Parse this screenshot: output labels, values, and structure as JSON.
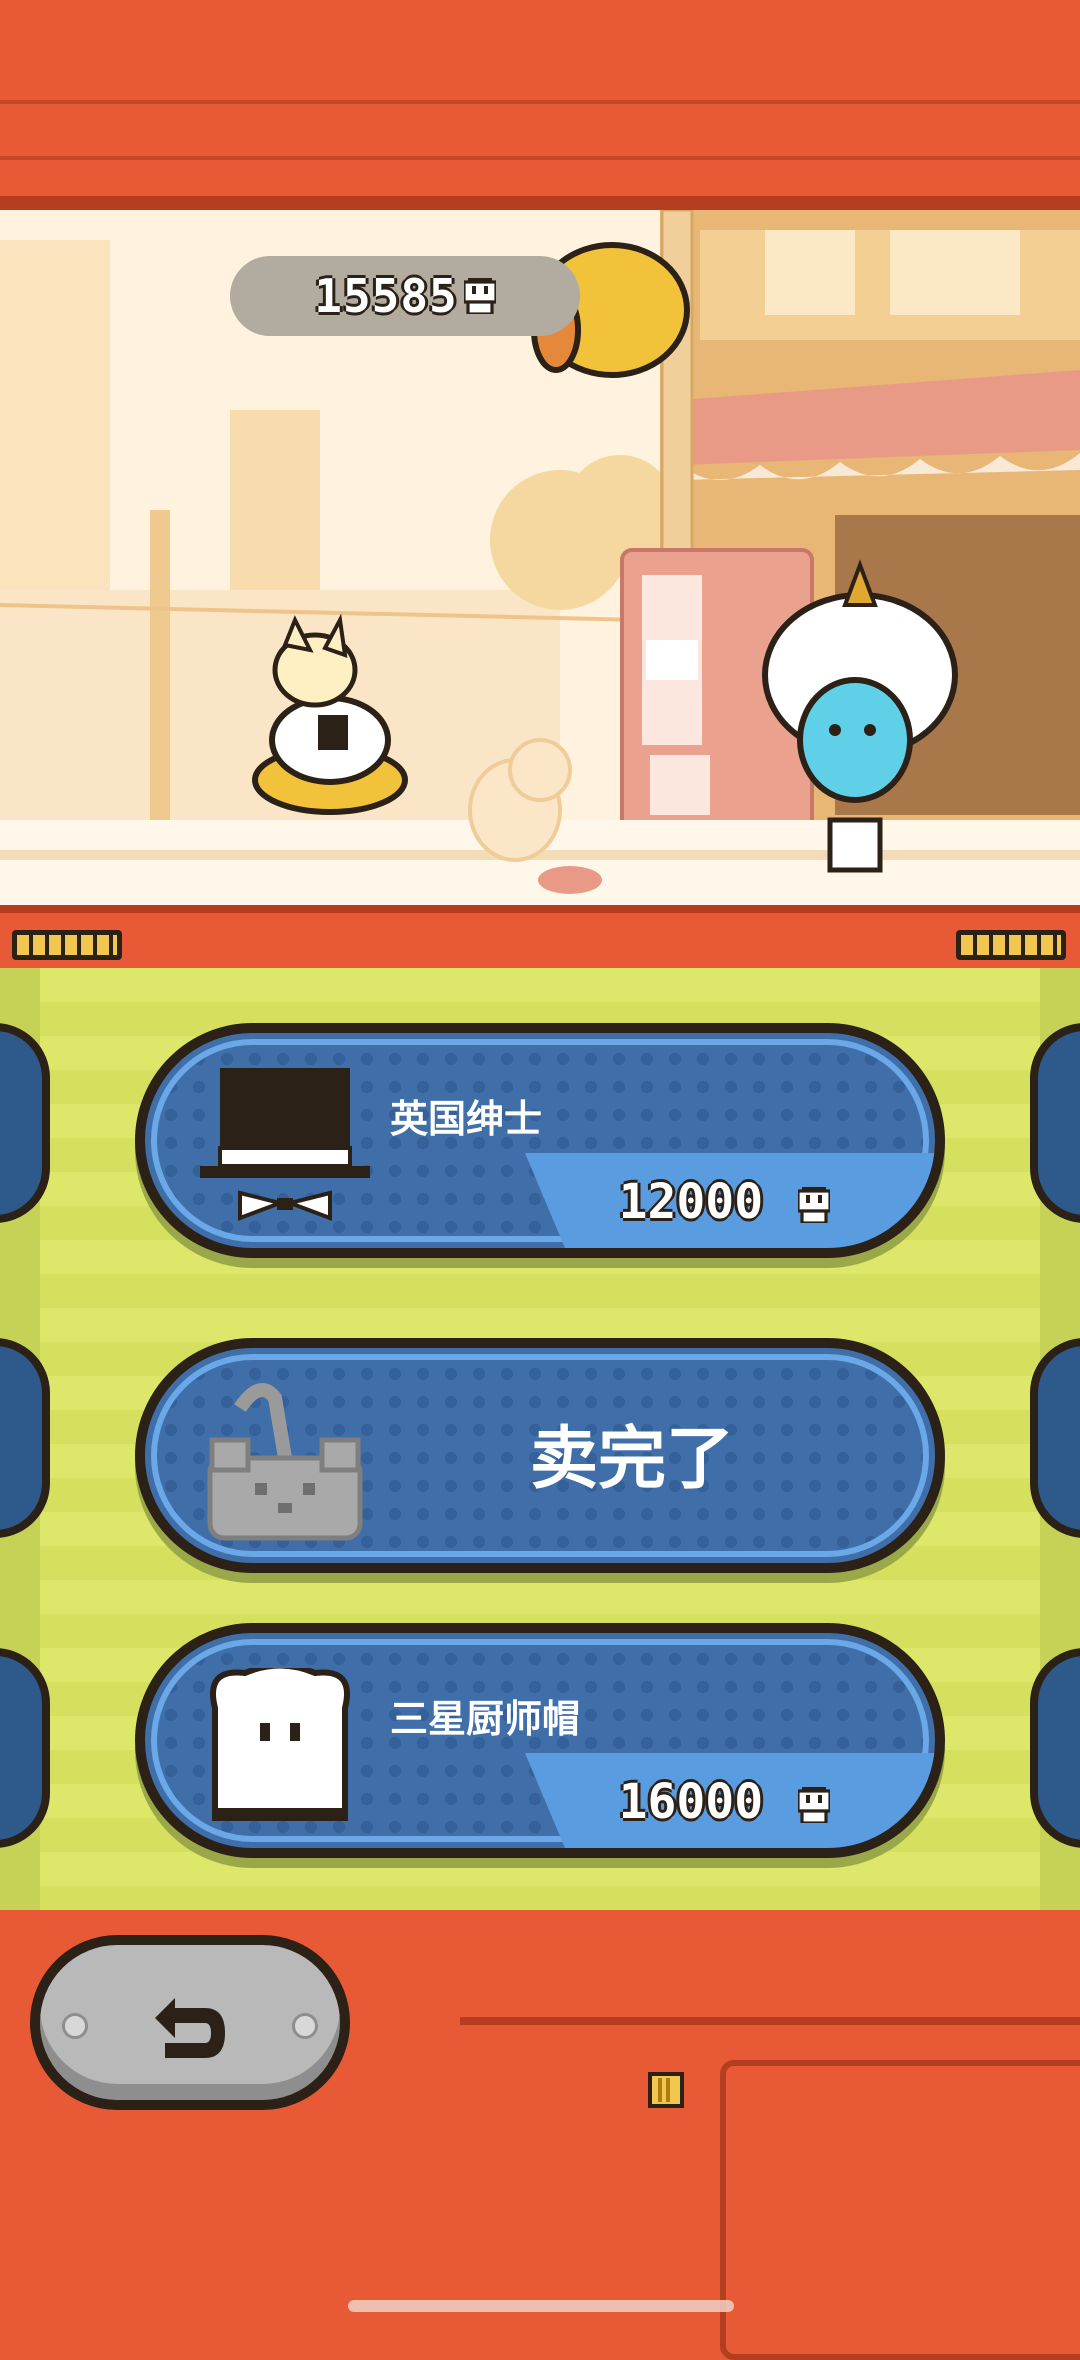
{
  "hud": {
    "coins": "15585"
  },
  "shop": {
    "items": [
      {
        "name": "英国绅士",
        "price": "12000",
        "icon": "top-hat-icon",
        "status": "available"
      },
      {
        "name": "",
        "status_text": "卖完了",
        "icon": "cat-hat-icon",
        "status": "sold-out"
      },
      {
        "name": "三星厨师帽",
        "price": "16000",
        "icon": "chef-hat-icon",
        "status": "available"
      }
    ]
  },
  "controls": {
    "back_icon": "back-arrow-icon"
  },
  "colors": {
    "frame": "#e85a36",
    "panel": "#dde86a",
    "card": "#3f6ea8",
    "card_accent": "#5a9ce0",
    "outline": "#2b2117"
  }
}
